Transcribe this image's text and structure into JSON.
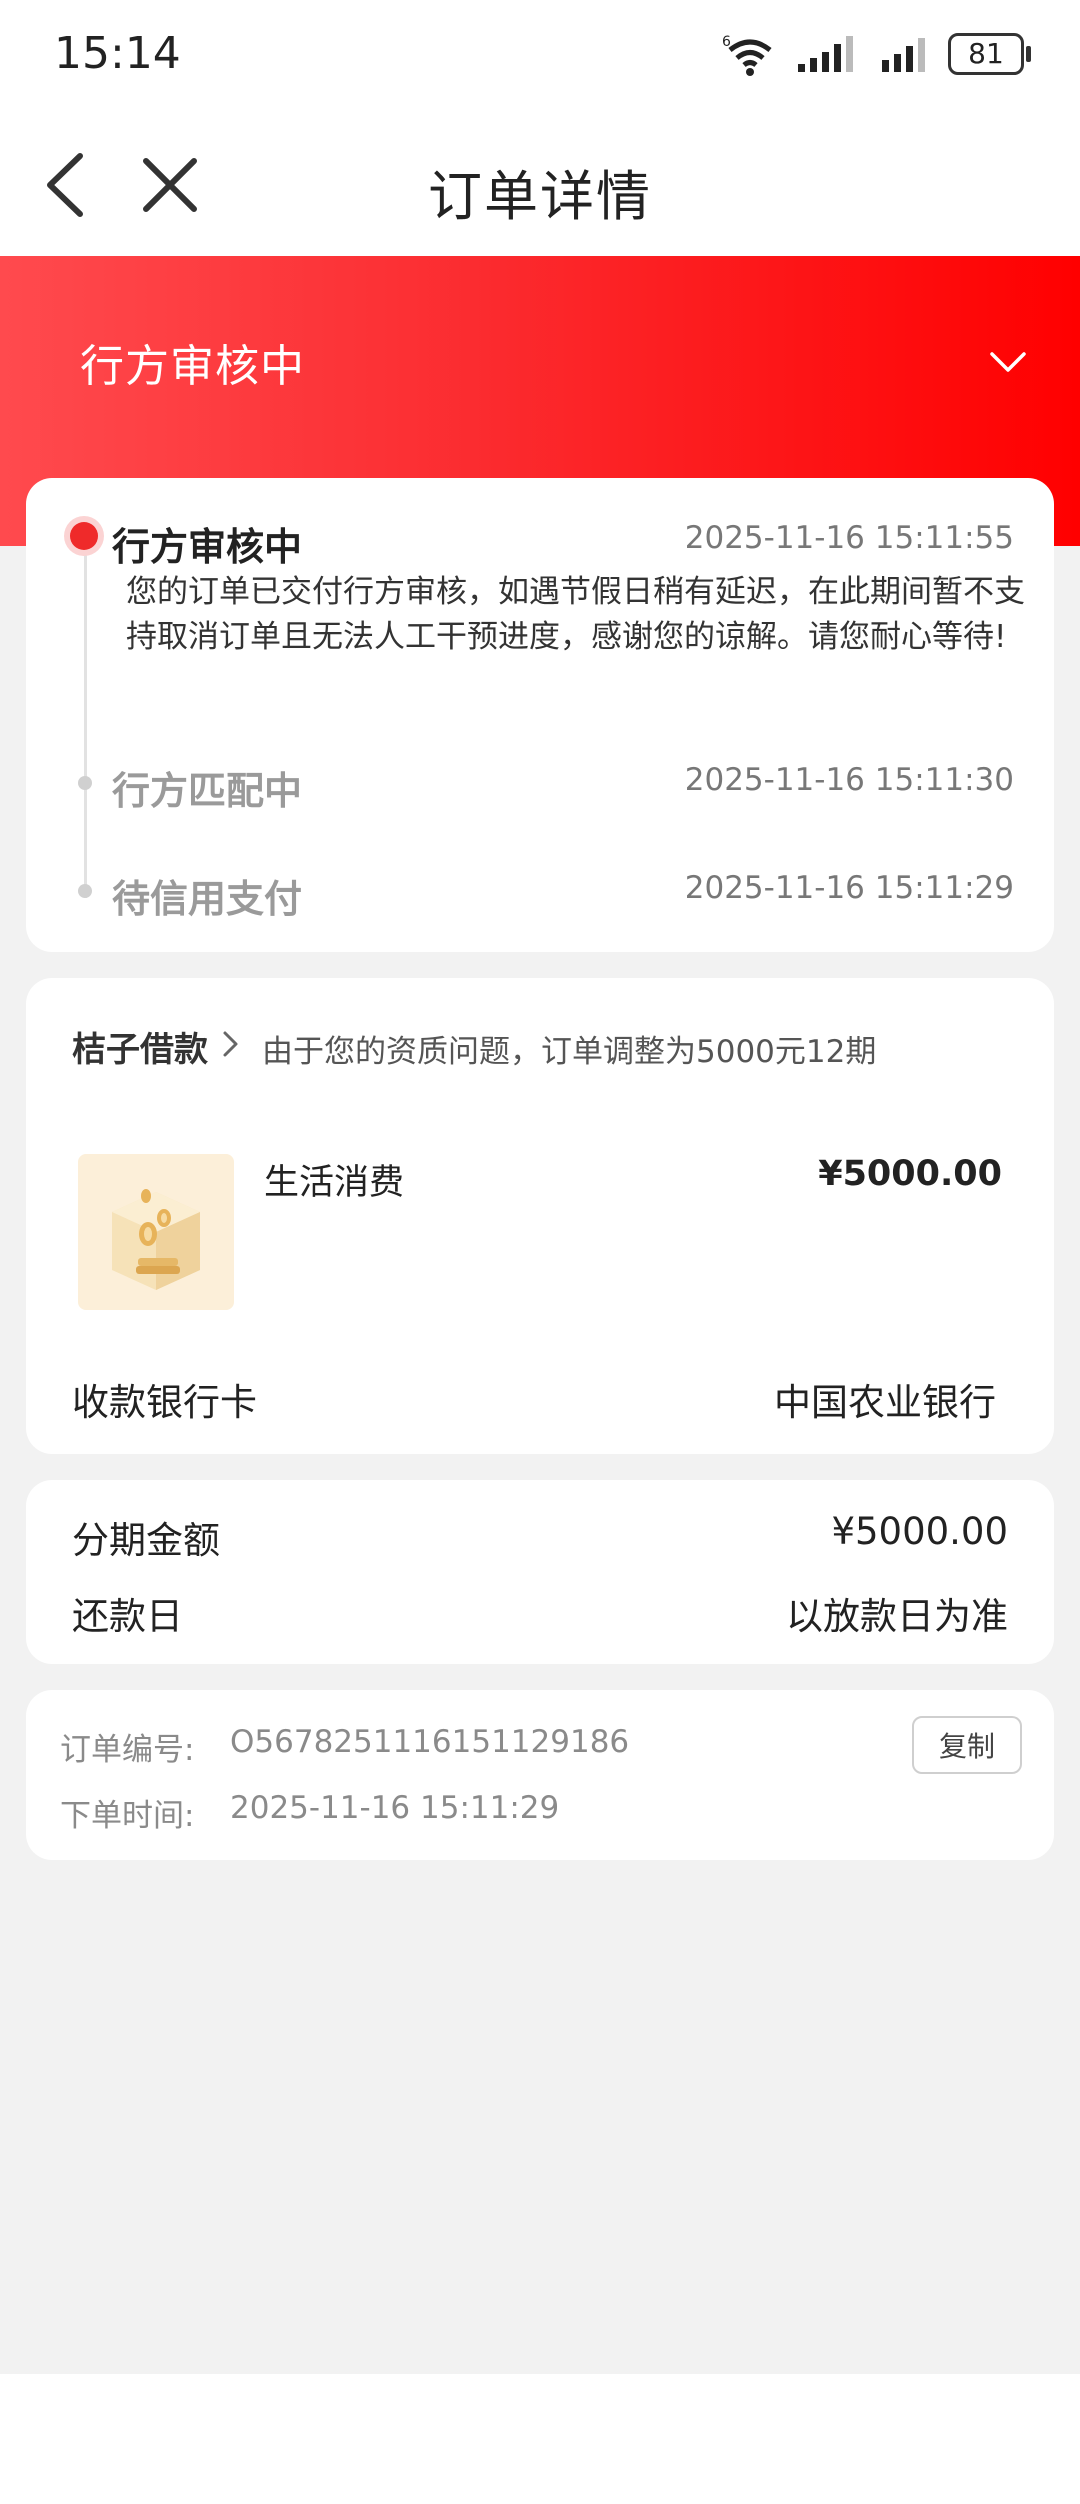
{
  "status_bar": {
    "time": "15:14",
    "network_label": "6",
    "battery_level": "81"
  },
  "nav": {
    "title": "订单详情",
    "back_icon": "chevron-left-icon",
    "close_icon": "close-icon"
  },
  "banner": {
    "status_title": "行方审核中",
    "expand_icon": "chevron-down-icon"
  },
  "timeline": [
    {
      "title": "行方审核中",
      "time": "2025-11-16 15:11:55",
      "description": "您的订单已交付行方审核，如遇节假日稍有延迟，在此期间暂不支持取消订单且无法人工干预进度，感谢您的谅解。请您耐心等待!"
    },
    {
      "title": "行方匹配中",
      "time": "2025-11-16 15:11:30"
    },
    {
      "title": "待信用支付",
      "time": "2025-11-16 15:11:29"
    }
  ],
  "product": {
    "lender": "桔子借款",
    "note": "由于您的资质问题，订单调整为5000元12期",
    "name": "生活消费",
    "price": "¥5000.00",
    "bank_label": "收款银行卡",
    "bank_value": "中国农业银行"
  },
  "amount": {
    "installment_label": "分期金额",
    "installment_value": "¥5000.00",
    "repay_label": "还款日",
    "repay_value": "以放款日为准"
  },
  "order": {
    "number_label": "订单编号:",
    "number_value": "O567825111615112918​6",
    "copy_label": "复制",
    "time_label": "下单时间:",
    "time_value": "2025-11-16 15:11:29"
  },
  "colors": {
    "accent": "#ef2a2a",
    "banner_start": "#ff4a4e",
    "banner_end": "#ff0000",
    "background": "#f2f2f2"
  }
}
